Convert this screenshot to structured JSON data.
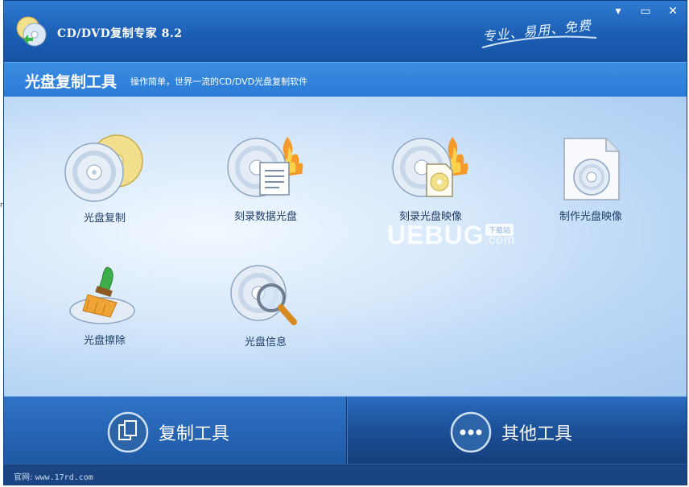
{
  "window": {
    "title": "CD/DVD复制专家 8.2",
    "slogan": "专业、易用、免费",
    "controls": {
      "minimize": "▾",
      "restore": "▭",
      "close": "✕"
    }
  },
  "header": {
    "title": "光盘复制工具",
    "subtitle": "操作简单，世界一流的CD/DVD光盘复制软件"
  },
  "tools": [
    {
      "label": "光盘复制",
      "icon": "disc-copy-icon"
    },
    {
      "label": "刻录数据光盘",
      "icon": "burn-data-disc-icon"
    },
    {
      "label": "刻录光盘映像",
      "icon": "burn-disc-image-icon"
    },
    {
      "label": "制作光盘映像",
      "icon": "make-disc-image-icon"
    },
    {
      "label": "光盘擦除",
      "icon": "disc-erase-icon"
    },
    {
      "label": "光盘信息",
      "icon": "disc-info-icon"
    }
  ],
  "watermark": {
    "text": "UEBUG",
    "suffix": ".com",
    "badge": "下载站"
  },
  "bottom_nav": [
    {
      "label": "复制工具",
      "icon": "copy-tools-icon",
      "active": true
    },
    {
      "label": "其他工具",
      "icon": "more-tools-icon",
      "active": false
    }
  ],
  "status": {
    "prefix": "官网:",
    "url": "www.17rd.com"
  },
  "edge_char": "n",
  "colors": {
    "titlebar": "#1c5fb5",
    "content_bg": "#d9eafb",
    "bottom_bar": "#1b4f96",
    "label_text": "#1f3d66"
  }
}
